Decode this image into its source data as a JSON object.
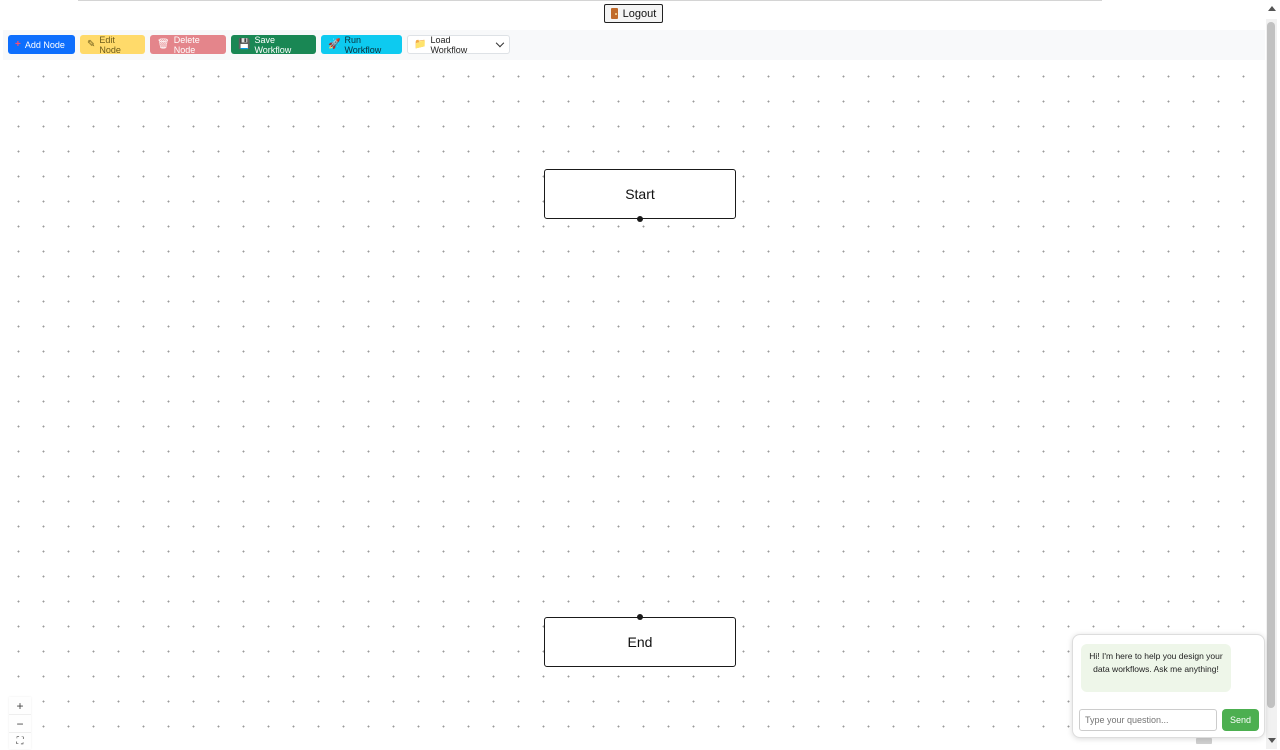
{
  "header": {
    "logout_label": "Logout"
  },
  "toolbar": {
    "add_node": "Add Node",
    "edit_node": "Edit Node",
    "delete_node": "Delete Node",
    "save_workflow": "Save Workflow",
    "run_workflow": "Run Workflow",
    "load_workflow": "Load Workflow"
  },
  "icons": {
    "add": "plus-icon",
    "edit": "pencil-icon",
    "delete": "trash-icon",
    "save": "floppy-disk-icon",
    "run": "rocket-icon",
    "load": "folder-icon",
    "logout": "door-icon"
  },
  "canvas": {
    "nodes": [
      {
        "label": "Start"
      },
      {
        "label": "End"
      }
    ]
  },
  "zoom": {
    "in": "+",
    "out": "−",
    "fit": "⛶"
  },
  "chat": {
    "greeting": "Hi! I'm here to help you design your data workflows. Ask me anything!",
    "input_placeholder": "Type your question...",
    "send_label": "Send"
  },
  "colors": {
    "add": "#0d6efd",
    "edit": "#ffda6a",
    "delete": "#e4858b",
    "save": "#198754",
    "run": "#0dcaf0",
    "send": "#4caf50"
  }
}
